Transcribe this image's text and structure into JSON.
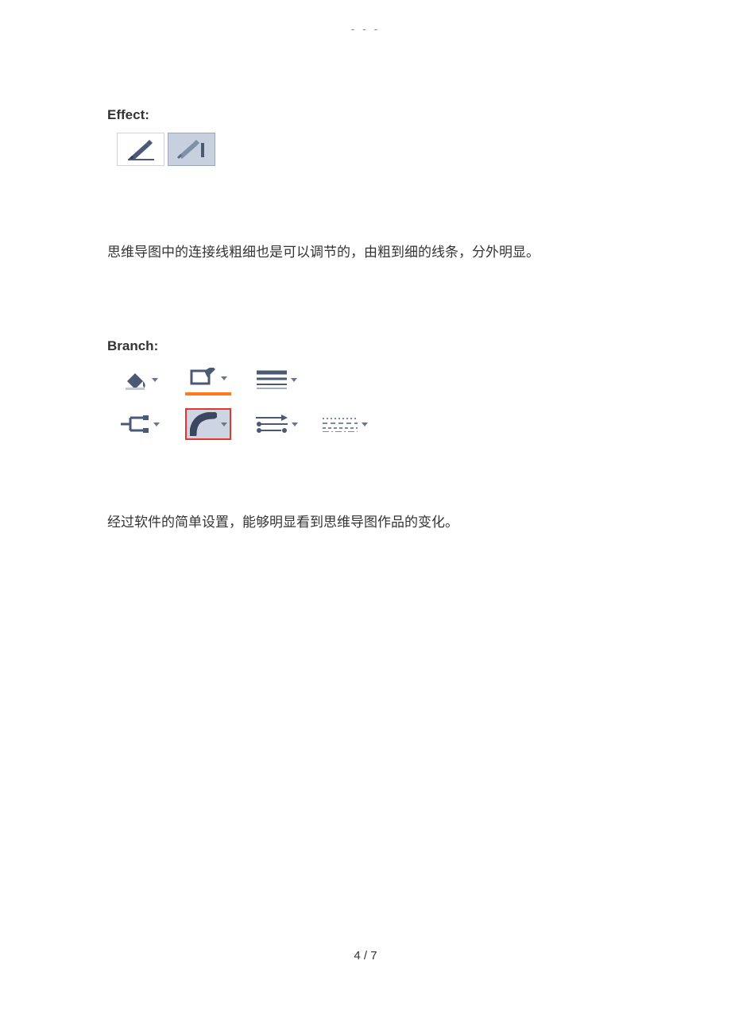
{
  "header": {
    "dashes": "- - -"
  },
  "effect": {
    "label": "Effect:"
  },
  "paragraph1": "思维导图中的连接线粗细也是可以调节的，由粗到细的线条，分外明显。",
  "branch": {
    "label": "Branch:"
  },
  "paragraph2": "经过软件的简单设置，能够明显看到思维导图作品的变化。",
  "pageNumber": "4 / 7",
  "icons": {
    "pen_plain": "pen-icon",
    "pen_shadowed": "pen-shadowed-icon",
    "fill_bucket": "fill-bucket-icon",
    "highlight": "highlight-icon",
    "line_width": "line-width-icon",
    "connector": "connector-icon",
    "curve": "curve-icon",
    "arrows": "arrows-icon",
    "dashes": "dashes-icon"
  }
}
